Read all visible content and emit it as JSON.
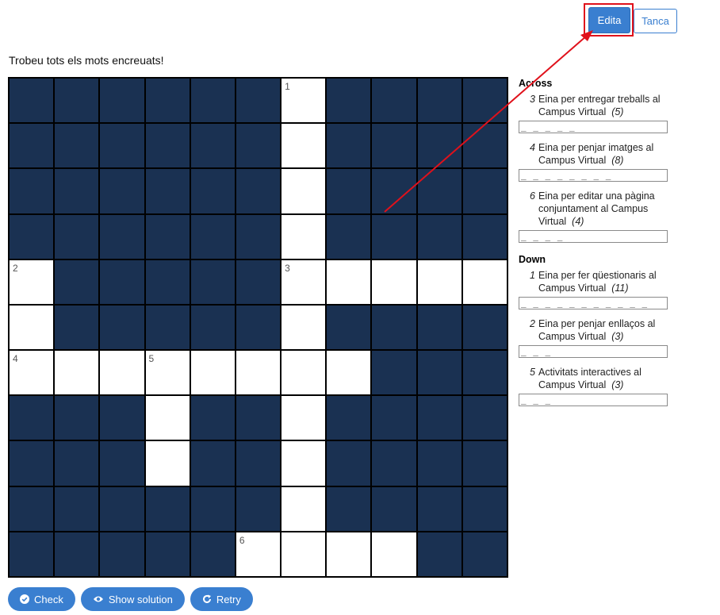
{
  "header": {
    "edit_label": "Edita",
    "close_label": "Tanca"
  },
  "instruction": "Trobeu tots els mots encreuats!",
  "grid": {
    "rows": 11,
    "cols": 11,
    "white_cells": [
      [
        0,
        6
      ],
      [
        1,
        6
      ],
      [
        2,
        6
      ],
      [
        3,
        6
      ],
      [
        4,
        0
      ],
      [
        4,
        6
      ],
      [
        4,
        7
      ],
      [
        4,
        8
      ],
      [
        4,
        9
      ],
      [
        4,
        10
      ],
      [
        5,
        0
      ],
      [
        5,
        6
      ],
      [
        6,
        0
      ],
      [
        6,
        1
      ],
      [
        6,
        2
      ],
      [
        6,
        3
      ],
      [
        6,
        4
      ],
      [
        6,
        5
      ],
      [
        6,
        6
      ],
      [
        6,
        7
      ],
      [
        7,
        3
      ],
      [
        7,
        6
      ],
      [
        8,
        3
      ],
      [
        8,
        6
      ],
      [
        9,
        6
      ],
      [
        10,
        5
      ],
      [
        10,
        6
      ],
      [
        10,
        7
      ],
      [
        10,
        8
      ]
    ],
    "numbers": [
      {
        "row": 0,
        "col": 6,
        "n": "1"
      },
      {
        "row": 4,
        "col": 0,
        "n": "2"
      },
      {
        "row": 4,
        "col": 6,
        "n": "3"
      },
      {
        "row": 6,
        "col": 0,
        "n": "4"
      },
      {
        "row": 6,
        "col": 3,
        "n": "5"
      },
      {
        "row": 10,
        "col": 5,
        "n": "6"
      }
    ]
  },
  "clues": {
    "across_heading": "Across",
    "across": [
      {
        "num": "3",
        "text": "Eina per entregar treballs al Campus Virtual",
        "length": "(5)",
        "placeholder": "_ _ _ _ _"
      },
      {
        "num": "4",
        "text": "Eina per penjar imatges al Campus Virtual",
        "length": "(8)",
        "placeholder": "_ _ _ _ _ _ _ _"
      },
      {
        "num": "6",
        "text": "Eina per editar una pàgina conjuntament al Campus Virtual",
        "length": "(4)",
        "placeholder": "_ _ _ _"
      }
    ],
    "down_heading": "Down",
    "down": [
      {
        "num": "1",
        "text": "Eina per fer qüestionaris al Campus Virtual",
        "length": "(11)",
        "placeholder": "_ _ _ _ _ _ _ _ _ _ _"
      },
      {
        "num": "2",
        "text": "Eina per penjar enllaços al Campus Virtual",
        "length": "(3)",
        "placeholder": "_ _ _"
      },
      {
        "num": "5",
        "text": "Activitats interactives al Campus Virtual",
        "length": "(3)",
        "placeholder": "_ _ _"
      }
    ]
  },
  "actions": {
    "check_label": "Check",
    "show_solution_label": "Show solution",
    "retry_label": "Retry"
  },
  "colors": {
    "accent": "#3a7fd0",
    "dark_cell": "#1a3152",
    "annotation": "#e0111b"
  }
}
